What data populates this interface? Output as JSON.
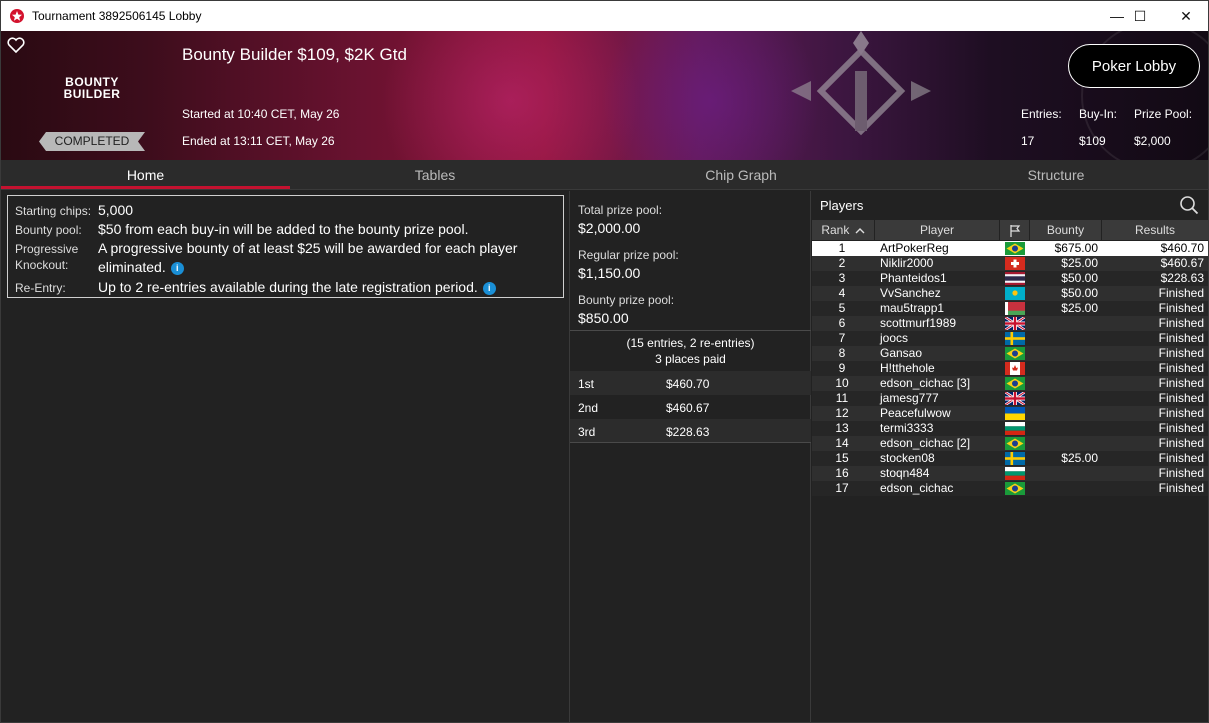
{
  "window": {
    "title": "Tournament 3892506145 Lobby",
    "controls": {
      "minimize": "—",
      "maximize": "☐",
      "close": "✕"
    }
  },
  "banner": {
    "logo_line1": "BOUNTY",
    "logo_line2": "BUILDER",
    "status": "COMPLETED",
    "tournament_name": "Bounty Builder $109, $2K Gtd",
    "started": "Started at 10:40 CET, May 26",
    "ended": "Ended at 13:11 CET, May 26",
    "lobby_button": "Poker Lobby",
    "stats": {
      "entries_label": "Entries:",
      "entries_value": "17",
      "buyin_label": "Buy-In:",
      "buyin_value": "$109",
      "prizepool_label": "Prize Pool:",
      "prizepool_value": "$2,000"
    }
  },
  "tabs": {
    "home": "Home",
    "tables": "Tables",
    "chip_graph": "Chip Graph",
    "structure": "Structure"
  },
  "info": {
    "starting_chips_label": "Starting chips:",
    "starting_chips_value": "5,000",
    "bounty_pool_label": "Bounty pool:",
    "bounty_pool_value": "$50 from each buy-in will be added to the bounty prize pool.",
    "progressive_label_1": "Progressive",
    "progressive_label_2": "Knockout:",
    "progressive_value_1": "A progressive bounty of at least $25 will be awarded for each player",
    "progressive_value_2": "eliminated.",
    "reentry_label": "Re-Entry:",
    "reentry_value": "Up to 2 re-entries available during the late registration period."
  },
  "prize": {
    "total_label": "Total prize pool:",
    "total_value": "$2,000.00",
    "regular_label": "Regular prize pool:",
    "regular_value": "$1,150.00",
    "bounty_label": "Bounty prize pool:",
    "bounty_value": "$850.00",
    "entries_note": "(15 entries, 2 re-entries)",
    "places_note": "3 places paid",
    "payouts": [
      {
        "place": "1st",
        "amount": "$460.70"
      },
      {
        "place": "2nd",
        "amount": "$460.67"
      },
      {
        "place": "3rd",
        "amount": "$228.63"
      }
    ]
  },
  "players": {
    "title": "Players",
    "headers": {
      "rank": "Rank",
      "player": "Player",
      "bounty": "Bounty",
      "results": "Results"
    },
    "rows": [
      {
        "rank": "1",
        "name": "ArtPokerReg",
        "flag": "brazil",
        "bounty": "$675.00",
        "result": "$460.70"
      },
      {
        "rank": "2",
        "name": "Niklir2000",
        "flag": "switzerland",
        "bounty": "$25.00",
        "result": "$460.67"
      },
      {
        "rank": "3",
        "name": "Phanteidos1",
        "flag": "thailand",
        "bounty": "$50.00",
        "result": "$228.63"
      },
      {
        "rank": "4",
        "name": "VvSanchez",
        "flag": "kazakhstan",
        "bounty": "$50.00",
        "result": "Finished"
      },
      {
        "rank": "5",
        "name": "mau5trapp1",
        "flag": "belarus",
        "bounty": "$25.00",
        "result": "Finished"
      },
      {
        "rank": "6",
        "name": "scottmurf1989",
        "flag": "uk",
        "bounty": "",
        "result": "Finished"
      },
      {
        "rank": "7",
        "name": "joocs",
        "flag": "sweden",
        "bounty": "",
        "result": "Finished"
      },
      {
        "rank": "8",
        "name": "Gansao",
        "flag": "brazil",
        "bounty": "",
        "result": "Finished"
      },
      {
        "rank": "9",
        "name": "H!tthehole",
        "flag": "canada",
        "bounty": "",
        "result": "Finished"
      },
      {
        "rank": "10",
        "name": "edson_cichac [3]",
        "flag": "brazil",
        "bounty": "",
        "result": "Finished"
      },
      {
        "rank": "11",
        "name": "jamesg777",
        "flag": "uk",
        "bounty": "",
        "result": "Finished"
      },
      {
        "rank": "12",
        "name": "Peacefulwow",
        "flag": "ukraine",
        "bounty": "",
        "result": "Finished"
      },
      {
        "rank": "13",
        "name": "termi3333",
        "flag": "bulgaria",
        "bounty": "",
        "result": "Finished"
      },
      {
        "rank": "14",
        "name": "edson_cichac [2]",
        "flag": "brazil",
        "bounty": "",
        "result": "Finished"
      },
      {
        "rank": "15",
        "name": "stocken08",
        "flag": "sweden",
        "bounty": "$25.00",
        "result": "Finished"
      },
      {
        "rank": "16",
        "name": "stoqn484",
        "flag": "bulgaria",
        "bounty": "",
        "result": "Finished"
      },
      {
        "rank": "17",
        "name": "edson_cichac",
        "flag": "brazil",
        "bounty": "",
        "result": "Finished"
      }
    ]
  },
  "colors": {
    "accent_red": "#c41230",
    "info_blue": "#1a8fd6",
    "panel_bg": "#222222"
  }
}
